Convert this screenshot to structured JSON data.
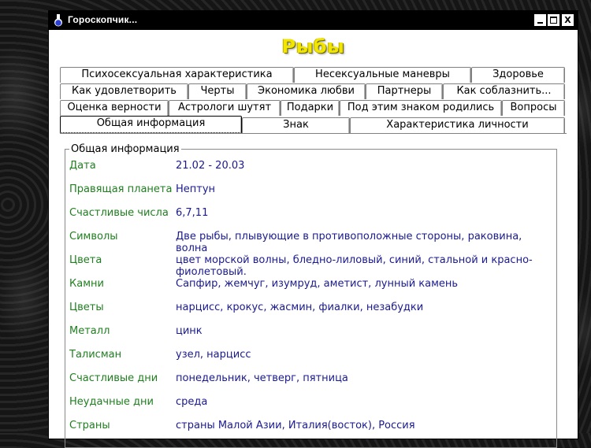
{
  "window": {
    "title": "Гороскопчик...",
    "controls": {
      "minimize": "",
      "maximize": "",
      "close": "X"
    }
  },
  "sign_title": "Рыбы",
  "tabs": [
    {
      "label": "Психосексуальная характеристика"
    },
    {
      "label": "Несексуальные маневры"
    },
    {
      "label": "Здоровье"
    },
    {
      "label": "Как удовлетворить"
    },
    {
      "label": "Черты"
    },
    {
      "label": "Экономика любви"
    },
    {
      "label": "Партнеры"
    },
    {
      "label": "Как соблазнить..."
    },
    {
      "label": "Оценка верности"
    },
    {
      "label": "Астрологи шутят"
    },
    {
      "label": "Подарки"
    },
    {
      "label": "Под этим знаком родились"
    },
    {
      "label": "Вопросы"
    },
    {
      "label": "Общая информация"
    },
    {
      "label": "Знак"
    },
    {
      "label": "Характеристика личности"
    }
  ],
  "active_tab": "Общая информация",
  "group": {
    "legend": "Общая информация",
    "rows": [
      {
        "label": "Дата",
        "value": "21.02 - 20.03"
      },
      {
        "label": "Правящая планета",
        "value": "Нептун"
      },
      {
        "label": "Счастливые числа",
        "value": "6,7,11"
      },
      {
        "label": "Символы",
        "value": "Две рыбы, плывующие в противоположные стороны, раковина, волна"
      },
      {
        "label": "Цвета",
        "value": "цвет морской волны, бледно-лиловый, синий, стальной и красно-фиолетовый."
      },
      {
        "label": "Камни",
        "value": "Сапфир, жемчуг, изумруд, аметист, лунный камень"
      },
      {
        "label": "Цветы",
        "value": "нарцисс, крокус, жасмин, фиалки, незабудки"
      },
      {
        "label": "Металл",
        "value": "цинк"
      },
      {
        "label": "Талисман",
        "value": "узел, нарцисс"
      },
      {
        "label": "Счастливые дни",
        "value": "понедельник, четверг, пятница"
      },
      {
        "label": "Неудачные дни",
        "value": "среда"
      },
      {
        "label": "Страны",
        "value": "страны Малой Азии, Италия(восток), Россия"
      }
    ]
  },
  "colors": {
    "label": "#1f7f1f",
    "value": "#1a1a8e",
    "title_yellow": "#f2e600",
    "titlebar": "#000000"
  }
}
